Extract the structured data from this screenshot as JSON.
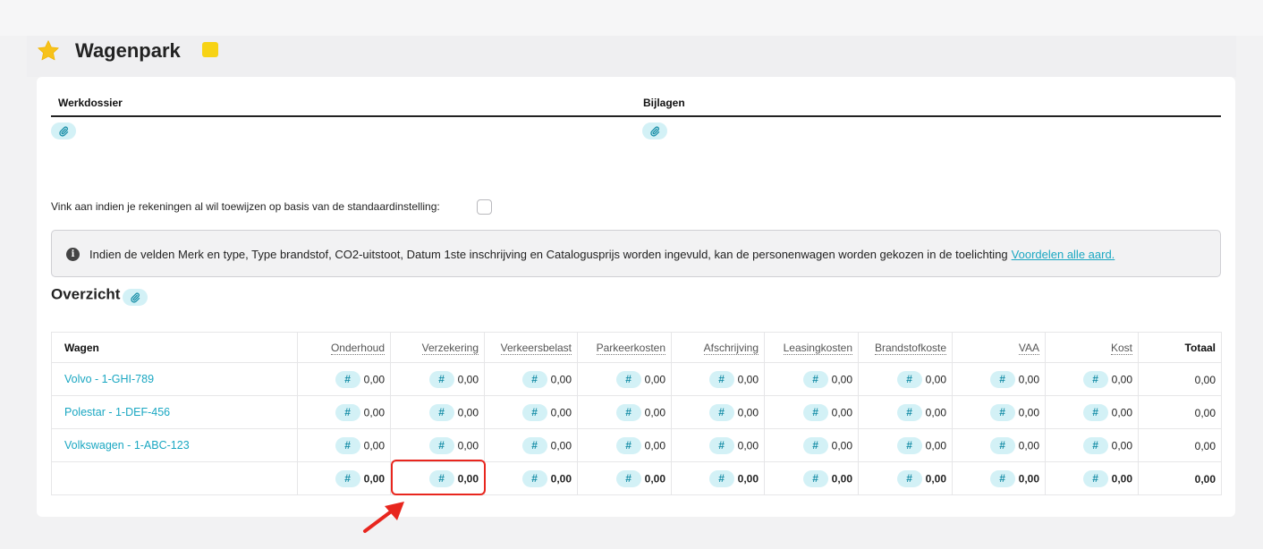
{
  "header": {
    "title": "Wagenpark",
    "accent_color": "#f7d315",
    "star_icon": "star-icon"
  },
  "files": {
    "werkdossier_label": "Werkdossier",
    "bijlagen_label": "Bijlagen",
    "attach_icon": "paperclip-icon"
  },
  "option": {
    "label": "Vink aan indien je rekeningen al wil toewijzen op basis van de standaardinstelling:",
    "checked": false
  },
  "info": {
    "text": "Indien de velden Merk en type, Type brandstof, CO2-uitstoot, Datum 1ste inschrijving en Catalogusprijs worden ingevuld, kan de personenwagen worden gekozen in de toelichting",
    "link": "Voordelen alle aard."
  },
  "overview": {
    "title": "Overzicht",
    "columns": [
      "Wagen",
      "Onderhoud",
      "Verzekering",
      "Verkeersbelast",
      "Parkeerkosten",
      "Afschrijving",
      "Leasingkosten",
      "Brandstofkoste",
      "VAA",
      "Kost",
      "Totaal"
    ],
    "rows": [
      {
        "car": "Volvo - 1-GHI-789",
        "values": [
          "0,00",
          "0,00",
          "0,00",
          "0,00",
          "0,00",
          "0,00",
          "0,00",
          "0,00",
          "0,00",
          "0,00"
        ]
      },
      {
        "car": "Polestar - 1-DEF-456",
        "values": [
          "0,00",
          "0,00",
          "0,00",
          "0,00",
          "0,00",
          "0,00",
          "0,00",
          "0,00",
          "0,00",
          "0,00"
        ]
      },
      {
        "car": "Volkswagen - 1-ABC-123",
        "values": [
          "0,00",
          "0,00",
          "0,00",
          "0,00",
          "0,00",
          "0,00",
          "0,00",
          "0,00",
          "0,00",
          "0,00"
        ]
      }
    ],
    "totals": [
      "0,00",
      "0,00",
      "0,00",
      "0,00",
      "0,00",
      "0,00",
      "0,00",
      "0,00",
      "0,00",
      "0,00"
    ],
    "hash_symbol": "#",
    "link_color": "#1aa7c2"
  },
  "annotation": {
    "highlight_color": "#e8261e",
    "highlighted_cell": "Verzekering total"
  }
}
